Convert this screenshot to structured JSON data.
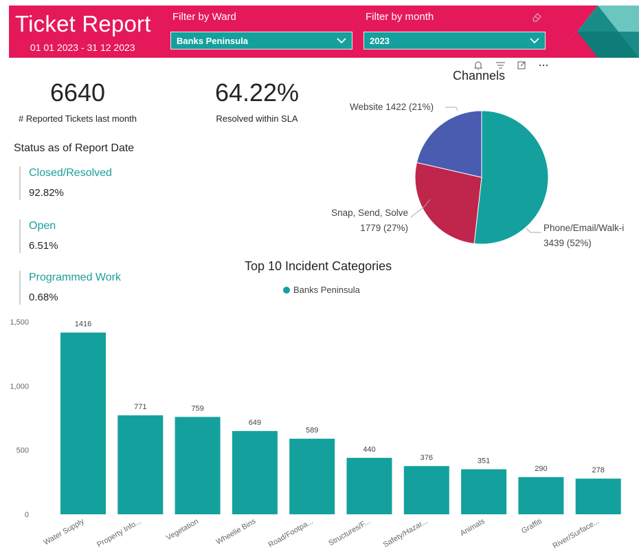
{
  "header": {
    "title": "Ticket Report",
    "date_range": "01 01 2023 - 31 12 2023",
    "ward_filter_label": "Filter by Ward",
    "ward_filter_value": "Banks Peninsula",
    "month_filter_label": "Filter by month",
    "month_filter_value": "2023",
    "bg_color": "#e5195a"
  },
  "kpis": {
    "reported_value": "6640",
    "reported_label": "# Reported Tickets last month",
    "sla_value": "64.22%",
    "sla_label": "Resolved within SLA"
  },
  "status": {
    "heading": "Status as of Report Date",
    "items": [
      {
        "name": "Closed/Resolved",
        "value": "92.82%"
      },
      {
        "name": "Open",
        "value": "6.51%"
      },
      {
        "name": "Programmed Work",
        "value": "0.68%"
      }
    ]
  },
  "visual_toolbar": {
    "icons": [
      "bell-icon",
      "filter-icon",
      "focus-mode-icon",
      "more-options-icon"
    ]
  },
  "chart_data": [
    {
      "type": "pie",
      "title": "Channels",
      "slices": [
        {
          "label": "Phone/Email/Walk-i",
          "value": 3439,
          "percent": "52%",
          "color": "#14a19d"
        },
        {
          "label": "Snap, Send, Solve",
          "value": 1779,
          "percent": "27%",
          "color": "#c0254b"
        },
        {
          "label": "Website",
          "value": 1422,
          "percent": "21%",
          "color": "#4a5cb0"
        }
      ],
      "labels_text": {
        "website": "Website 1422 (21%)",
        "sss_line1": "Snap, Send, Solve",
        "sss_line2": "1779 (27%)",
        "phone_line1": "Phone/Email/Walk-i",
        "phone_line2": "3439 (52%)"
      }
    },
    {
      "type": "bar",
      "title": "Top 10 Incident Categories",
      "legend": "Banks Peninsula",
      "legend_color": "#14a19d",
      "categories": [
        "Water Supply",
        "Property Info...",
        "Vegetation",
        "Wheelie Bins",
        "Road/Footpa...",
        "Structures/F...",
        "Safety/Hazar...",
        "Animals",
        "Graffiti",
        "River/Surface..."
      ],
      "values": [
        1416,
        771,
        759,
        649,
        589,
        440,
        376,
        351,
        290,
        278
      ],
      "ylim": [
        0,
        1500
      ],
      "yticks": [
        0,
        500,
        1000,
        1500
      ],
      "ytick_labels": [
        "0",
        "500",
        "1,000",
        "1,500"
      ],
      "bar_color": "#14a19d"
    }
  ]
}
